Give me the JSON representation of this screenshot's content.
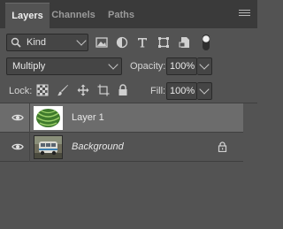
{
  "tabs": [
    {
      "label": "Layers",
      "active": true
    },
    {
      "label": "Channels",
      "active": false
    },
    {
      "label": "Paths",
      "active": false
    }
  ],
  "filter": {
    "kind_label": "Kind",
    "filter_icons": [
      "image-filter-icon",
      "adjustment-filter-icon",
      "type-filter-icon",
      "shape-filter-icon",
      "smart-object-filter-icon",
      "filter-toggle-icon"
    ]
  },
  "blend": {
    "mode": "Multiply",
    "opacity_label": "Opacity:",
    "opacity_value": "100%"
  },
  "lock": {
    "label": "Lock:",
    "icons": [
      "lock-transparent-pixels-icon",
      "lock-image-pixels-icon",
      "lock-position-icon",
      "lock-artboard-icon",
      "lock-all-icon"
    ],
    "fill_label": "Fill:",
    "fill_value": "100%"
  },
  "layers": [
    {
      "name": "Layer 1",
      "selected": true,
      "visible": true,
      "italic": false,
      "locked": false
    },
    {
      "name": "Background",
      "selected": false,
      "visible": true,
      "italic": true,
      "locked": true
    }
  ],
  "colors": {
    "panel_bg": "#535353",
    "tabbar_bg": "#3a3a3a",
    "selected_row": "#6c6c6c"
  }
}
